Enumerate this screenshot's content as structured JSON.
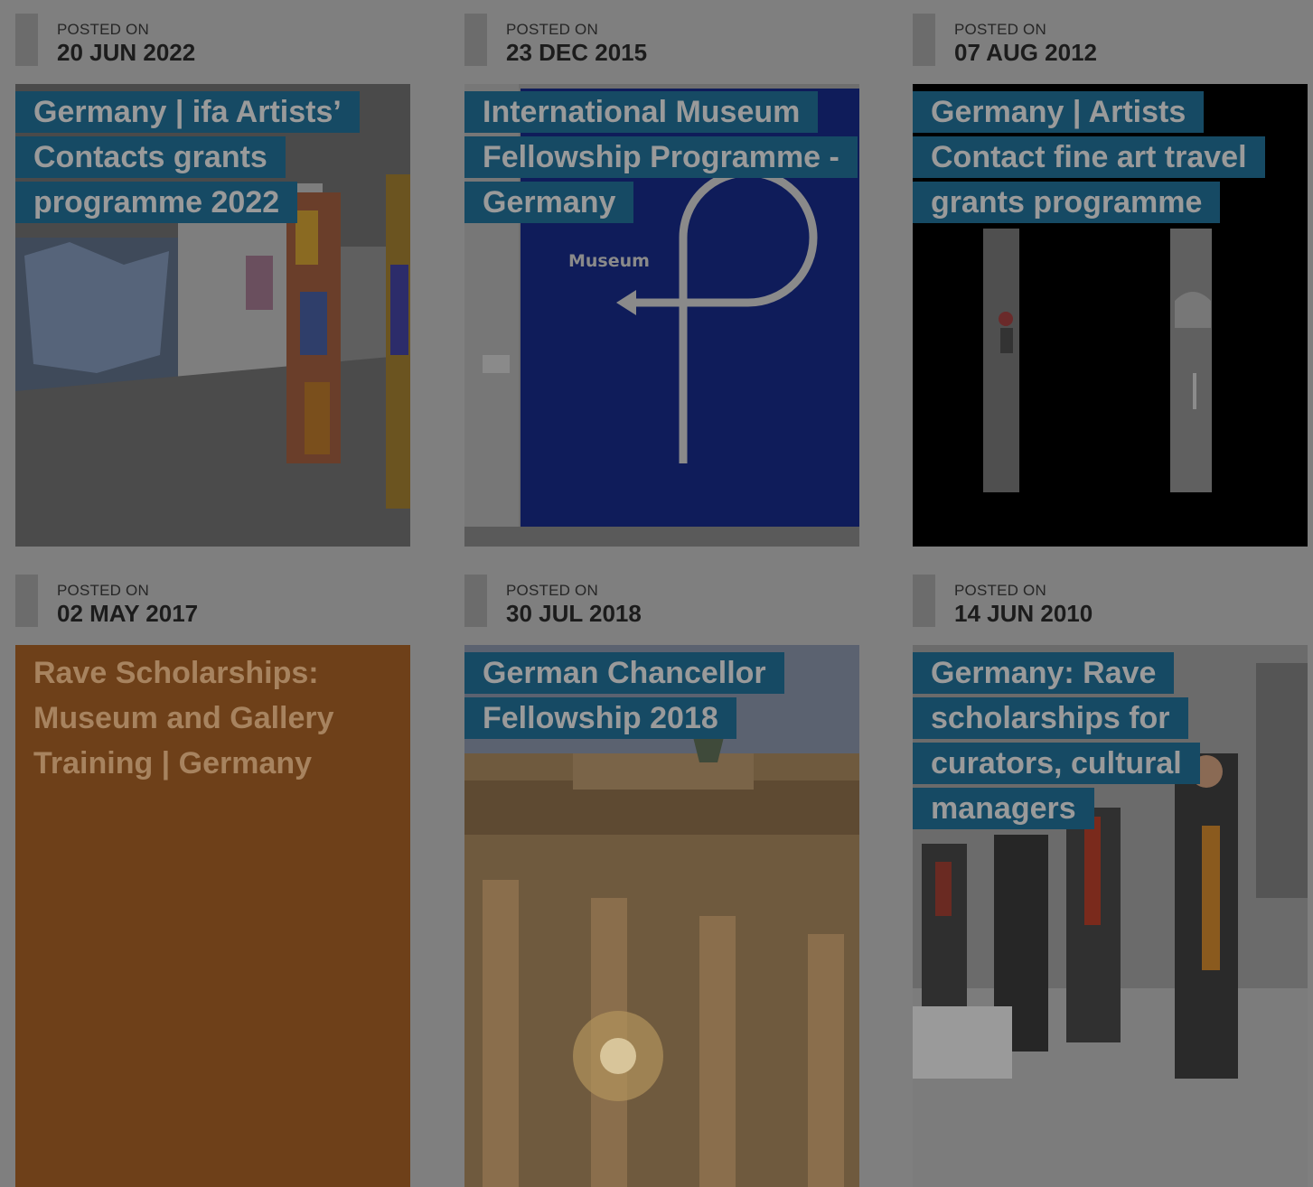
{
  "posted_label": "POSTED ON",
  "colors": {
    "page_background": "#7f7f7f",
    "title_highlight": "#164a64",
    "orange_card": "#6e4019"
  },
  "cards": [
    {
      "date": "20 JUN 2022",
      "title": "Germany | ifa Artists’ Contacts grants programme 2022",
      "image": "gallery-exhibition-photo"
    },
    {
      "date": "23 DEC 2015",
      "title": "International Museum Fellowship Programme - Germany",
      "image": "museum-direction-sign"
    },
    {
      "date": "07 AUG 2012",
      "title": "Germany | Artists Contact fine art travel grants programme",
      "image": "street-photo-strips"
    },
    {
      "date": "02 MAY 2017",
      "title": "Rave Scholarships: Museum and Gallery Training | Germany",
      "image": "none"
    },
    {
      "date": "30 JUL 2018",
      "title": "German Chancellor Fellowship 2018",
      "image": "brandenburg-gate-photo"
    },
    {
      "date": "14 JUN 2010",
      "title": "Germany: Rave scholarships for curators, cultural managers",
      "image": "group-of-people-photo"
    }
  ],
  "sign_text": "Museum"
}
